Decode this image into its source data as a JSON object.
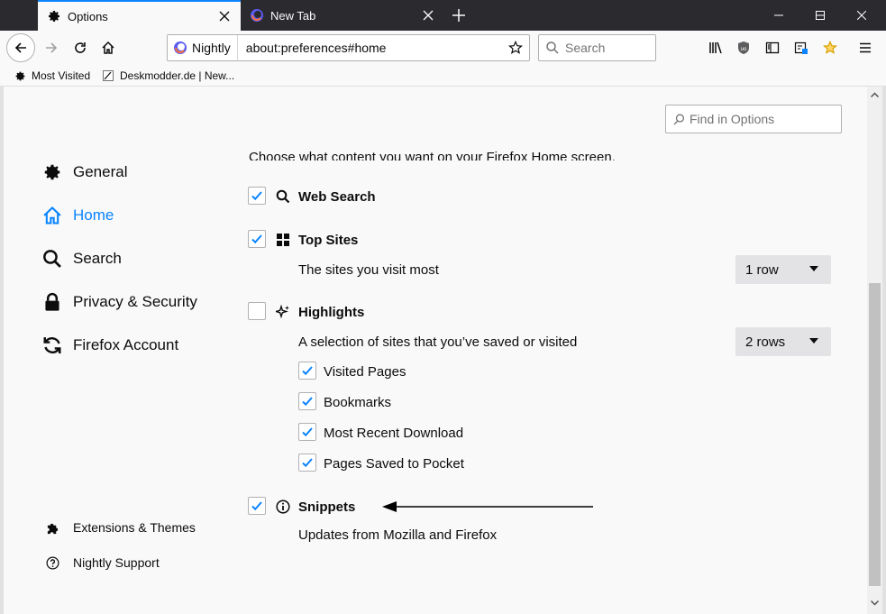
{
  "tabs": [
    {
      "title": "Options",
      "icon": "gear-icon",
      "active": true
    },
    {
      "title": "New Tab",
      "icon": "firefox-nightly-icon",
      "active": false
    }
  ],
  "navbar": {
    "identity_label": "Nightly",
    "url": "about:preferences#home",
    "search_placeholder": "Search"
  },
  "bookmarks": [
    {
      "label": "Most Visited",
      "icon": "gear-icon"
    },
    {
      "label": "Deskmodder.de | New...",
      "icon": "page-icon"
    }
  ],
  "find_placeholder": "Find in Options",
  "sidebar": {
    "items": [
      {
        "label": "General",
        "icon": "gear-icon"
      },
      {
        "label": "Home",
        "icon": "home-icon",
        "selected": true
      },
      {
        "label": "Search",
        "icon": "search-icon"
      },
      {
        "label": "Privacy & Security",
        "icon": "lock-icon"
      },
      {
        "label": "Firefox Account",
        "icon": "sync-icon"
      }
    ],
    "footer": [
      {
        "label": "Extensions & Themes",
        "icon": "puzzle-icon"
      },
      {
        "label": "Nightly Support",
        "icon": "help-icon"
      }
    ]
  },
  "home": {
    "intro_text": "Choose what content you want on your Firefox Home screen.",
    "web_search": {
      "label": "Web Search",
      "checked": true
    },
    "top_sites": {
      "label": "Top Sites",
      "checked": true,
      "desc": "The sites you visit most",
      "rows": "1 row"
    },
    "highlights": {
      "label": "Highlights",
      "checked": false,
      "desc": "A selection of sites that you’ve saved or visited",
      "rows": "2 rows",
      "sub": [
        {
          "label": "Visited Pages",
          "checked": true
        },
        {
          "label": "Bookmarks",
          "checked": true
        },
        {
          "label": "Most Recent Download",
          "checked": true
        },
        {
          "label": "Pages Saved to Pocket",
          "checked": true
        }
      ]
    },
    "snippets": {
      "label": "Snippets",
      "checked": true,
      "desc": "Updates from Mozilla and Firefox"
    }
  },
  "colors": {
    "accent": "#0a84ff",
    "tabstrip": "#2b2a2f"
  }
}
